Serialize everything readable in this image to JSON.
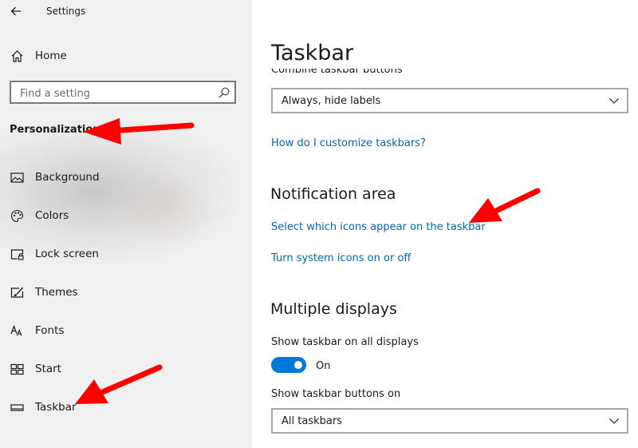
{
  "window": {
    "title": "Settings"
  },
  "sidebar": {
    "home_label": "Home",
    "search_placeholder": "Find a setting",
    "section_title": "Personalization",
    "items": [
      {
        "label": "Background",
        "icon": "picture-icon"
      },
      {
        "label": "Colors",
        "icon": "palette-icon"
      },
      {
        "label": "Lock screen",
        "icon": "lock-screen-icon"
      },
      {
        "label": "Themes",
        "icon": "themes-brush-icon"
      },
      {
        "label": "Fonts",
        "icon": "fonts-icon"
      },
      {
        "label": "Start",
        "icon": "start-tiles-icon"
      },
      {
        "label": "Taskbar",
        "icon": "taskbar-icon"
      }
    ]
  },
  "main": {
    "title": "Taskbar",
    "combine_label": "Combine taskbar buttons",
    "combine_value": "Always, hide labels",
    "customize_link": "How do I customize taskbars?",
    "notification_heading": "Notification area",
    "notification_links": [
      "Select which icons appear on the taskbar",
      "Turn system icons on or off"
    ],
    "multiple_heading": "Multiple displays",
    "show_all_label": "Show taskbar on all displays",
    "toggle_state": "On",
    "show_buttons_label": "Show taskbar buttons on",
    "show_buttons_value": "All taskbars"
  },
  "colors": {
    "accent": "#0078d7",
    "link": "#0067b8",
    "annotation_arrow": "#ff0000"
  }
}
